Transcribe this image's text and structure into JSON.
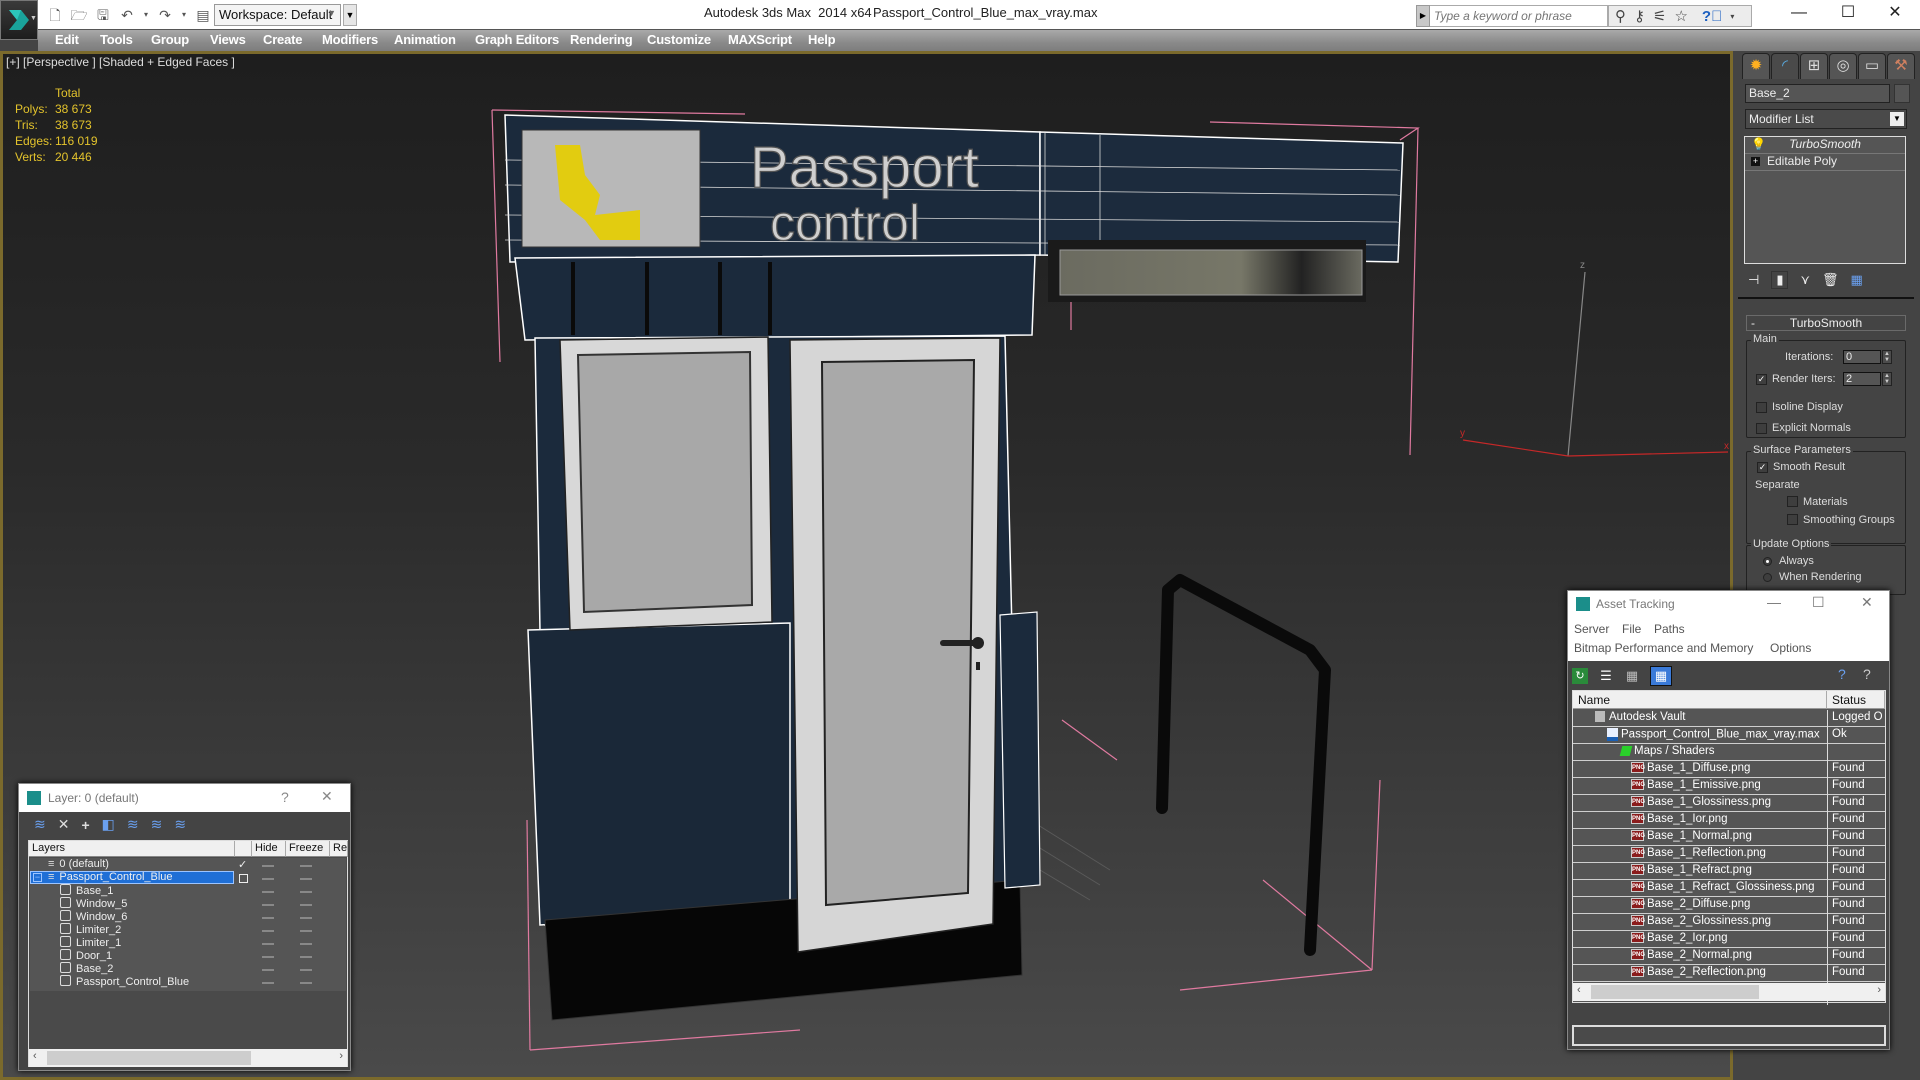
{
  "titlebar": {
    "app_title": "Autodesk 3ds Max  2014 x64",
    "file_name": "Passport_Control_Blue_max_vray.max",
    "workspace": "Workspace: Default",
    "search_placeholder": "Type a keyword or phrase",
    "window_controls": {
      "minimize": "—",
      "maximize": "☐",
      "close": "✕"
    },
    "quick_access_icons": [
      "new-file-icon",
      "open-folder-icon",
      "save-icon",
      "undo-icon",
      "redo-icon",
      "project-folder-icon"
    ],
    "info_icons": [
      "binoculars-icon",
      "key-icon",
      "satellite-icon",
      "star-icon",
      "help-icon"
    ]
  },
  "menu": [
    "Edit",
    "Tools",
    "Group",
    "Views",
    "Create",
    "Modifiers",
    "Animation",
    "Graph Editors",
    "Rendering",
    "Customize",
    "MAXScript",
    "Help"
  ],
  "viewport": {
    "label": "[+] [Perspective ] [Shaded + Edged Faces ]",
    "stats": {
      "header": "Total",
      "rows": [
        {
          "label": "Polys:",
          "value": "38 673"
        },
        {
          "label": "Tris:",
          "value": "38 673"
        },
        {
          "label": "Edges:",
          "value": "116 019"
        },
        {
          "label": "Verts:",
          "value": "20 446"
        }
      ]
    },
    "sign_text": [
      "Passport",
      "control"
    ],
    "axis_labels": {
      "x": "x",
      "y": "y",
      "z": "z"
    }
  },
  "command_panel": {
    "tabs": [
      "create-tab",
      "modify-tab",
      "hierarchy-tab",
      "motion-tab",
      "display-tab",
      "utilities-tab"
    ],
    "object_name": "Base_2",
    "modifier_list": "Modifier List",
    "stack": [
      "TurboSmooth",
      "Editable Poly"
    ],
    "rollout_title": "TurboSmooth",
    "main_group": "Main",
    "iterations_label": "Iterations:",
    "iterations_value": "0",
    "render_iters_label": "Render Iters:",
    "render_iters_value": "2",
    "render_iters_checked": true,
    "isoline_label": "Isoline Display",
    "isoline_checked": false,
    "explicit_normals_label": "Explicit Normals",
    "explicit_normals_checked": false,
    "surface_group": "Surface Parameters",
    "smooth_result_label": "Smooth Result",
    "smooth_result_checked": true,
    "separate_label": "Separate",
    "materials_label": "Materials",
    "materials_checked": false,
    "smoothing_groups_label": "Smoothing Groups",
    "smoothing_groups_checked": false,
    "update_group": "Update Options",
    "always_label": "Always",
    "when_rendering_label": "When Rendering",
    "update_selected": "Always"
  },
  "asset_tracking": {
    "title": "Asset Tracking",
    "menu_row1": [
      "Server",
      "File",
      "Paths"
    ],
    "menu_row2": [
      "Bitmap Performance and Memory",
      "Options"
    ],
    "columns": {
      "name": "Name",
      "status": "Status"
    },
    "rows": [
      {
        "name": "Autodesk Vault",
        "status": "Logged O",
        "level": 0,
        "icon": "vault-icon"
      },
      {
        "name": "Passport_Control_Blue_max_vray.max",
        "status": "Ok",
        "level": 1,
        "icon": "max-file-icon"
      },
      {
        "name": "Maps / Shaders",
        "status": "",
        "level": 2,
        "icon": "maps-icon"
      },
      {
        "name": "Base_1_Diffuse.png",
        "status": "Found",
        "level": 3,
        "icon": "png-icon"
      },
      {
        "name": "Base_1_Emissive.png",
        "status": "Found",
        "level": 3,
        "icon": "png-icon"
      },
      {
        "name": "Base_1_Glossiness.png",
        "status": "Found",
        "level": 3,
        "icon": "png-icon"
      },
      {
        "name": "Base_1_Ior.png",
        "status": "Found",
        "level": 3,
        "icon": "png-icon"
      },
      {
        "name": "Base_1_Normal.png",
        "status": "Found",
        "level": 3,
        "icon": "png-icon"
      },
      {
        "name": "Base_1_Reflection.png",
        "status": "Found",
        "level": 3,
        "icon": "png-icon"
      },
      {
        "name": "Base_1_Refract.png",
        "status": "Found",
        "level": 3,
        "icon": "png-icon"
      },
      {
        "name": "Base_1_Refract_Glossiness.png",
        "status": "Found",
        "level": 3,
        "icon": "png-icon"
      },
      {
        "name": "Base_2_Diffuse.png",
        "status": "Found",
        "level": 3,
        "icon": "png-icon"
      },
      {
        "name": "Base_2_Glossiness.png",
        "status": "Found",
        "level": 3,
        "icon": "png-icon"
      },
      {
        "name": "Base_2_Ior.png",
        "status": "Found",
        "level": 3,
        "icon": "png-icon"
      },
      {
        "name": "Base_2_Normal.png",
        "status": "Found",
        "level": 3,
        "icon": "png-icon"
      },
      {
        "name": "Base_2_Reflection.png",
        "status": "Found",
        "level": 3,
        "icon": "png-icon"
      }
    ]
  },
  "layer_dialog": {
    "title": "Layer: 0 (default)",
    "help": "?",
    "close": "✕",
    "toolbar_icons": [
      "new-layer-icon",
      "delete-layer-icon",
      "add-to-layer-icon",
      "select-objects-icon",
      "select-layer-icon",
      "highlight-layer-icon",
      "layer-settings-icon"
    ],
    "columns": [
      "Layers",
      "",
      "Hide",
      "Freeze",
      "Re"
    ],
    "rows": [
      {
        "name": "0 (default)",
        "type": "layer",
        "current": true,
        "selected": false
      },
      {
        "name": "Passport_Control_Blue",
        "type": "layer",
        "current": false,
        "selected": true
      },
      {
        "name": "Base_1",
        "type": "object"
      },
      {
        "name": "Window_5",
        "type": "object"
      },
      {
        "name": "Window_6",
        "type": "object"
      },
      {
        "name": "Limiter_2",
        "type": "object"
      },
      {
        "name": "Limiter_1",
        "type": "object"
      },
      {
        "name": "Door_1",
        "type": "object"
      },
      {
        "name": "Base_2",
        "type": "object"
      },
      {
        "name": "Passport_Control_Blue",
        "type": "object"
      }
    ]
  },
  "colors": {
    "viewport_border": "#7b6a2c",
    "stats_text": "#e3c32c",
    "selection_blue": "#1f6fd6",
    "booth_navy": "#1b2a3c"
  }
}
